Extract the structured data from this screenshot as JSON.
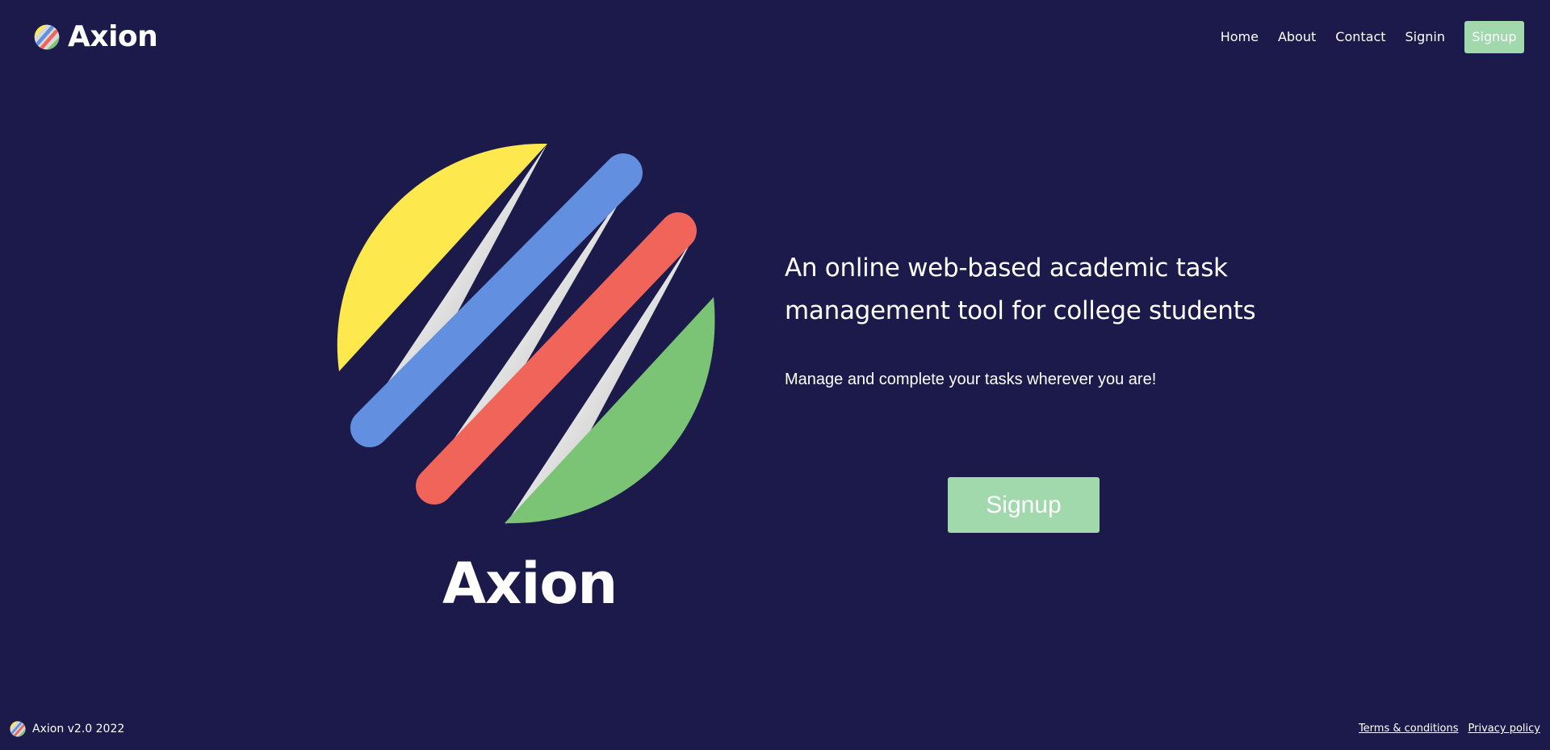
{
  "header": {
    "brand_name": "Axion",
    "logo_icon": "axion-logo-icon",
    "nav": {
      "home": "Home",
      "about": "About",
      "contact": "Contact",
      "signin": "Signin",
      "signup": "Signup"
    }
  },
  "hero": {
    "logo_name": "Axion",
    "headline": "An online web-based academic task management tool for college students",
    "subline": "Manage and complete your tasks wherever you are!",
    "cta_label": "Signup"
  },
  "footer": {
    "version": "Axion v2.0 2022",
    "terms": "Terms & conditions",
    "privacy": "Privacy policy"
  },
  "colors": {
    "background": "#1b1a4a",
    "accent": "#a1d9ad",
    "yellow": "#fde84d",
    "blue": "#628fe0",
    "red": "#f1645a",
    "green": "#7bc475"
  }
}
